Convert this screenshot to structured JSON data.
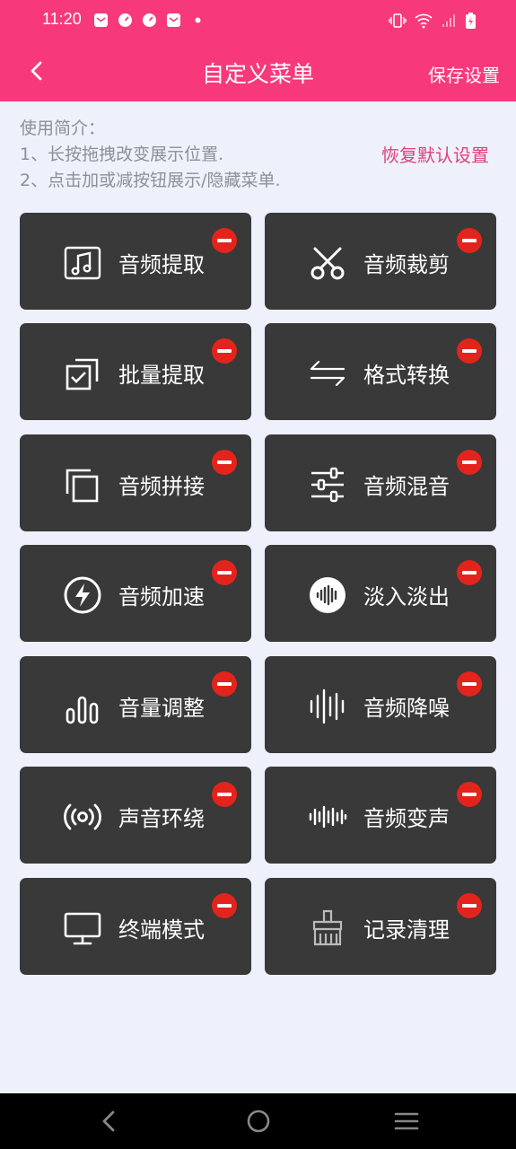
{
  "status_bar": {
    "time": "11:20"
  },
  "header": {
    "title": "自定义菜单",
    "save_label": "保存设置"
  },
  "intro": {
    "line1": "使用简介：",
    "line2": "1、长按拖拽改变展示位置.",
    "line3": "2、点击加或减按钮展示/隐藏菜单.",
    "restore_label": "恢复默认设置"
  },
  "menu_items": [
    {
      "label": "音频提取",
      "icon": "music-note-icon"
    },
    {
      "label": "音频裁剪",
      "icon": "scissors-icon"
    },
    {
      "label": "批量提取",
      "icon": "batch-check-icon"
    },
    {
      "label": "格式转换",
      "icon": "swap-arrows-icon"
    },
    {
      "label": "音频拼接",
      "icon": "copy-stack-icon"
    },
    {
      "label": "音频混音",
      "icon": "sliders-icon"
    },
    {
      "label": "音频加速",
      "icon": "lightning-icon"
    },
    {
      "label": "淡入淡出",
      "icon": "waveform-circle-icon"
    },
    {
      "label": "音量调整",
      "icon": "volume-bars-icon"
    },
    {
      "label": "音频降噪",
      "icon": "noise-wave-icon"
    },
    {
      "label": "声音环绕",
      "icon": "surround-broadcast-icon"
    },
    {
      "label": "音频变声",
      "icon": "voice-wave-icon"
    },
    {
      "label": "终端模式",
      "icon": "monitor-icon"
    },
    {
      "label": "记录清理",
      "icon": "broom-icon"
    }
  ],
  "colors": {
    "accent": "#f7397c",
    "card_bg": "#393939",
    "remove_badge": "#e3241c",
    "page_bg": "#eef1fb",
    "restore_text": "#e0407c"
  }
}
